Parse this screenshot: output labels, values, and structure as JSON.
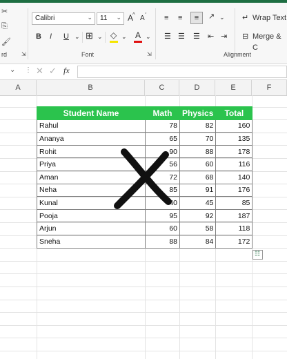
{
  "ribbon": {
    "font_name": "Calibri",
    "font_size": "11",
    "bold_label": "B",
    "italic_label": "I",
    "underline_label": "U",
    "font_color_label": "A",
    "font_group_label": "Font",
    "alignment_group_label": "Alignment",
    "clipboard_group_partial": "rd",
    "wrap_text_label": "Wrap Text",
    "merge_label": "Merge & C",
    "grow_font_label": "A",
    "shrink_font_label": "A",
    "fx_label": "fx"
  },
  "columns": [
    "A",
    "B",
    "C",
    "D",
    "E",
    "F"
  ],
  "table": {
    "headers": [
      "Student Name",
      "Math",
      "Physics",
      "Total"
    ],
    "rows": [
      [
        "Rahul",
        "78",
        "82",
        "160"
      ],
      [
        "Ananya",
        "65",
        "70",
        "135"
      ],
      [
        "Rohit",
        "90",
        "88",
        "178"
      ],
      [
        "Priya",
        "56",
        "60",
        "116"
      ],
      [
        "Aman",
        "72",
        "68",
        "140"
      ],
      [
        "Neha",
        "85",
        "91",
        "176"
      ],
      [
        "Kunal",
        "40",
        "45",
        "85"
      ],
      [
        "Pooja",
        "95",
        "92",
        "187"
      ],
      [
        "Arjun",
        "60",
        "58",
        "118"
      ],
      [
        "Sneha",
        "88",
        "84",
        "172"
      ]
    ]
  },
  "colors": {
    "header_fill": "#2bc34d",
    "header_text": "#ffffff",
    "excel_green": "#1e6e42",
    "x_mark": "#111111"
  }
}
